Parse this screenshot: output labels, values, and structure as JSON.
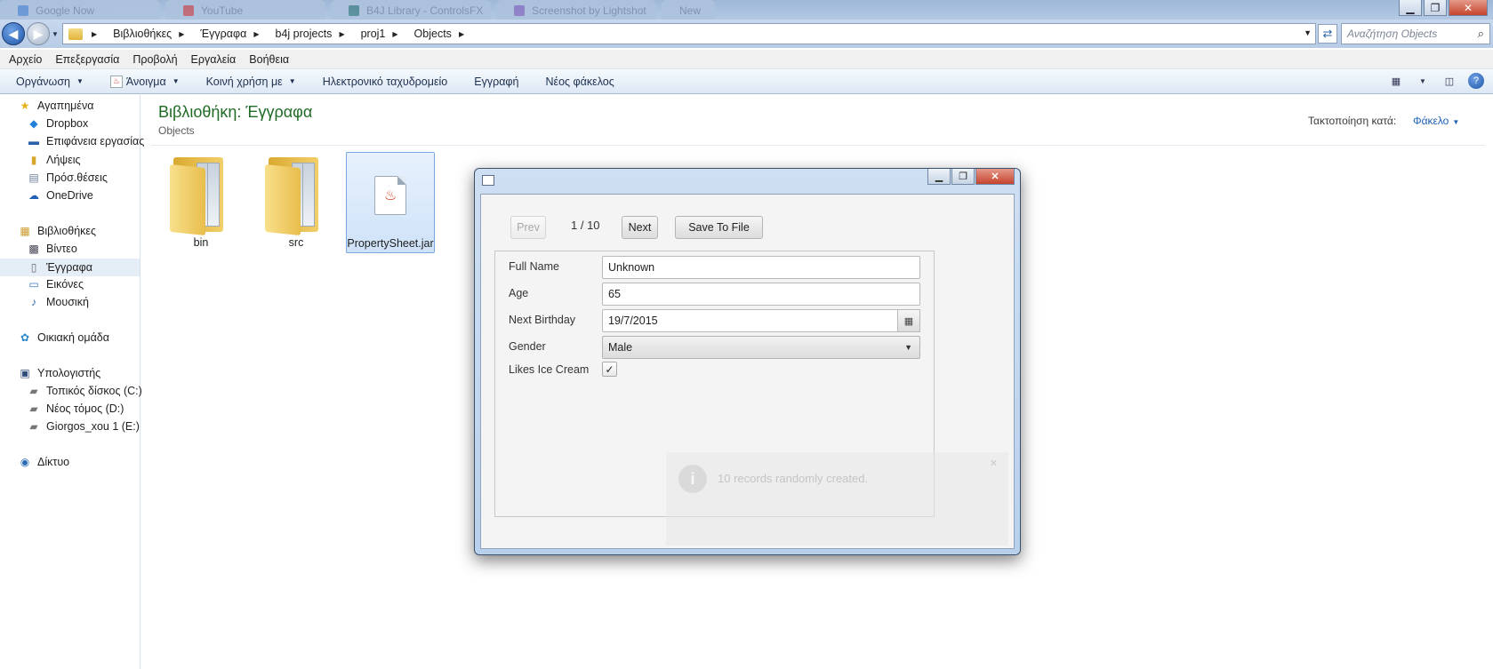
{
  "browser_tabs": [
    {
      "label": "Google Now",
      "color": "#3c7bd1"
    },
    {
      "label": "YouTube",
      "color": "#d12a2a"
    },
    {
      "label": "B4J Library - ControlsFX",
      "color": "#1b6a6a"
    },
    {
      "label": "Screenshot by Lightshot",
      "color": "#7b4fb5"
    },
    {
      "label": "New",
      "color": "#8a9bb3"
    }
  ],
  "address": {
    "crumbs": [
      "Βιβλιοθήκες",
      "Έγγραφα",
      "b4j projects",
      "proj1",
      "Objects"
    ],
    "search_placeholder": "Αναζήτηση Objects"
  },
  "menu": [
    "Αρχείο",
    "Επεξεργασία",
    "Προβολή",
    "Εργαλεία",
    "Βοήθεια"
  ],
  "commands": {
    "organize": "Οργάνωση",
    "open": "Άνοιγμα",
    "share": "Κοινή χρήση με",
    "email": "Ηλεκτρονικό ταχυδρομείο",
    "burn": "Εγγραφή",
    "new_folder": "Νέος φάκελος"
  },
  "sidebar": {
    "favorites": "Αγαπημένα",
    "dropbox": "Dropbox",
    "desktop": "Επιφάνεια εργασίας",
    "downloads": "Λήψεις",
    "recent": "Πρόσ.θέσεις",
    "onedrive": "OneDrive",
    "libraries": "Βιβλιοθήκες",
    "videos": "Βίντεο",
    "documents": "Έγγραφα",
    "pictures": "Εικόνες",
    "music": "Μουσική",
    "homegroup": "Οικιακή ομάδα",
    "computer": "Υπολογιστής",
    "drive_c": "Τοπικός δίσκος (C:)",
    "drive_d": "Νέος τόμος (D:)",
    "drive_e": "Giorgos_xou 1 (E:)",
    "network": "Δίκτυο"
  },
  "content": {
    "title": "Βιβλιοθήκη: Έγγραφα",
    "subtitle": "Objects",
    "arrange_label": "Τακτοποίηση κατά:",
    "arrange_value": "Φάκελο",
    "files": [
      "bin",
      "src",
      "PropertySheet.jar"
    ]
  },
  "dialog": {
    "prev": "Prev",
    "page": "1 / 10",
    "next": "Next",
    "save": "Save To File",
    "props": {
      "full_name_label": "Full Name",
      "full_name": "Unknown",
      "age_label": "Age",
      "age": "65",
      "birthday_label": "Next Birthday",
      "birthday": "19/7/2015",
      "gender_label": "Gender",
      "gender": "Male",
      "icecream_label": "Likes Ice Cream",
      "icecream_checked": true
    },
    "notification": "10 records randomly created."
  }
}
